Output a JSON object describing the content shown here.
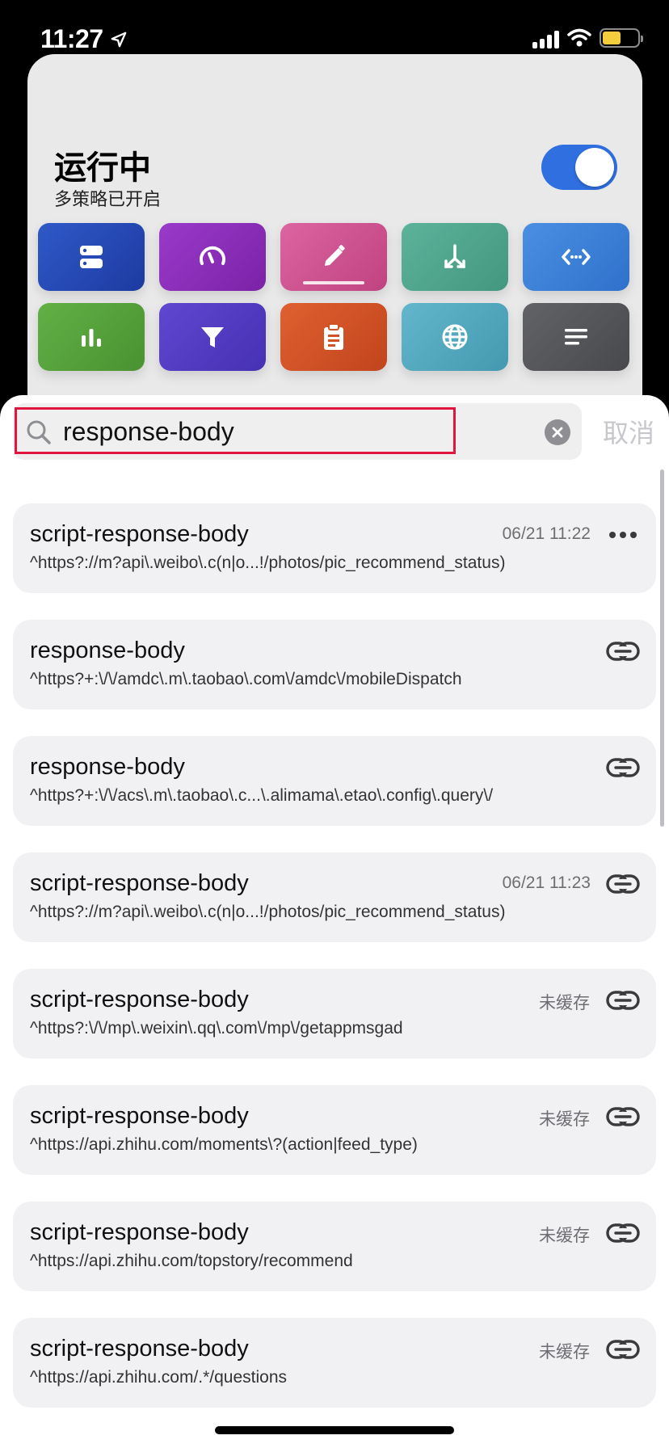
{
  "status_bar": {
    "time": "11:27"
  },
  "header": {
    "title": "运行中",
    "subtitle": "多策略已开启",
    "toggle_on": true
  },
  "tiles": [
    {
      "icon": "server-icon",
      "color": "#2448b2"
    },
    {
      "icon": "speedometer-icon",
      "color": "#8b2fb8"
    },
    {
      "icon": "pencil-icon",
      "color": "#cf5490",
      "active": true
    },
    {
      "icon": "merge-arrows-icon",
      "color": "#4fa58c"
    },
    {
      "icon": "code-dots-icon",
      "color": "#3a7fd6"
    },
    {
      "icon": "bar-chart-icon",
      "color": "#55a23b"
    },
    {
      "icon": "filter-icon",
      "color": "#5339c2"
    },
    {
      "icon": "clipboard-icon",
      "color": "#d25227"
    },
    {
      "icon": "globe-icon",
      "color": "#52a9c1"
    },
    {
      "icon": "text-lines-icon",
      "color": "#56575b"
    }
  ],
  "search": {
    "value": "response-body",
    "cancel_label": "取消"
  },
  "results": [
    {
      "name": "script-response-body",
      "pattern": "^https?://m?api\\.weibo\\.c(n|o...!/photos/pic_recommend_status)",
      "meta": "06/21 11:22",
      "action": "more"
    },
    {
      "name": "response-body",
      "pattern": "^https?+:\\/\\/amdc\\.m\\.taobao\\.com\\/amdc\\/mobileDispatch",
      "meta": "",
      "action": "link"
    },
    {
      "name": "response-body",
      "pattern": "^https?+:\\/\\/acs\\.m\\.taobao\\.c...\\.alimama\\.etao\\.config\\.query\\/",
      "meta": "",
      "action": "link"
    },
    {
      "name": "script-response-body",
      "pattern": "^https?://m?api\\.weibo\\.c(n|o...!/photos/pic_recommend_status)",
      "meta": "06/21 11:23",
      "action": "link"
    },
    {
      "name": "script-response-body",
      "pattern": "^https?:\\/\\/mp\\.weixin\\.qq\\.com\\/mp\\/getappmsgad",
      "meta": "未缓存",
      "action": "link"
    },
    {
      "name": "script-response-body",
      "pattern": "^https://api.zhihu.com/moments\\?(action|feed_type)",
      "meta": "未缓存",
      "action": "link"
    },
    {
      "name": "script-response-body",
      "pattern": "^https://api.zhihu.com/topstory/recommend",
      "meta": "未缓存",
      "action": "link"
    },
    {
      "name": "script-response-body",
      "pattern": "^https://api.zhihu.com/.*/questions",
      "meta": "未缓存",
      "action": "link"
    }
  ]
}
